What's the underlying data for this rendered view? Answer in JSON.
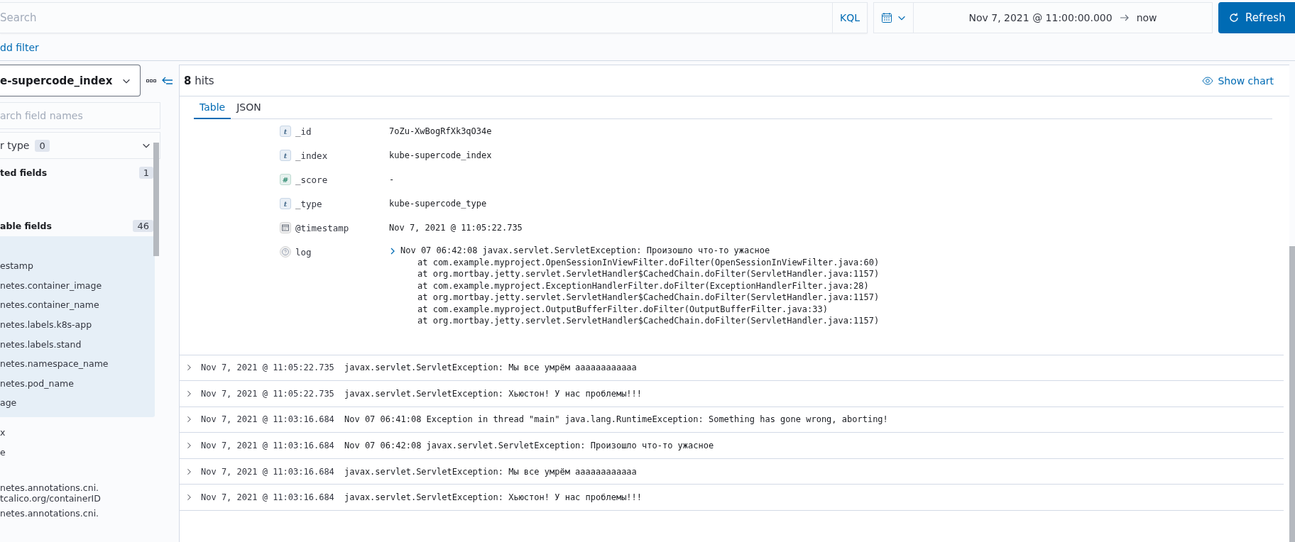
{
  "query_bar": {
    "placeholder": "Search",
    "language": "KQL"
  },
  "date_range": {
    "start": "Nov 7, 2021 @ 11:00:00.000",
    "end": "now"
  },
  "refresh_button": "Refresh",
  "add_filter": "dd filter",
  "sidebar": {
    "index_pattern": "e-supercode_index",
    "field_search": {
      "placeholder": "arch field names"
    },
    "type_filter": {
      "label": "r type",
      "count": "0"
    },
    "sections": [
      {
        "title": "ted fields",
        "count": "1"
      },
      {
        "title": "able fields",
        "count": "46",
        "fields": [
          "estamp",
          "netes.container_image",
          "netes.container_name",
          "netes.labels.k8s-app",
          "netes.labels.stand",
          "netes.namespace_name",
          "netes.pod_name",
          "age"
        ]
      }
    ],
    "other_fields": [
      [
        "x"
      ],
      [
        "e"
      ],
      [
        "netes.annotations.cni.",
        "tcalico.org/containerID"
      ],
      [
        "netes.annotations.cni."
      ]
    ]
  },
  "results": {
    "hits_count": "8",
    "hits_label": "hits",
    "show_chart": "Show chart",
    "tabs": [
      {
        "label": "Table",
        "selected": true
      },
      {
        "label": "JSON",
        "selected": false
      }
    ],
    "document": [
      {
        "kind": "string",
        "glyph": "t",
        "name": "_id",
        "value": "7oZu-XwBogRfXk3qO34e"
      },
      {
        "kind": "string",
        "glyph": "t",
        "name": "_index",
        "value": "kube-supercode_index"
      },
      {
        "kind": "number",
        "glyph": "#",
        "name": "_score",
        "value": "-"
      },
      {
        "kind": "string",
        "glyph": "t",
        "name": "_type",
        "value": "kube-supercode_type"
      },
      {
        "kind": "date",
        "name": "@timestamp",
        "value": "Nov 7, 2021 @ 11:05:22.735"
      },
      {
        "kind": "unknown",
        "name": "log",
        "lines": [
          "Nov 07 06:42:08 javax.servlet.ServletException: Произошло что-то ужасное",
          "at com.example.myproject.OpenSessionInViewFilter.doFilter(OpenSessionInViewFilter.java:60)",
          "at org.mortbay.jetty.servlet.ServletHandler$CachedChain.doFilter(ServletHandler.java:1157)",
          "at com.example.myproject.ExceptionHandlerFilter.doFilter(ExceptionHandlerFilter.java:28)",
          "at org.mortbay.jetty.servlet.ServletHandler$CachedChain.doFilter(ServletHandler.java:1157)",
          "at com.example.myproject.OutputBufferFilter.doFilter(OutputBufferFilter.java:33)",
          "at org.mortbay.jetty.servlet.ServletHandler$CachedChain.doFilter(ServletHandler.java:1157)"
        ]
      }
    ],
    "rows": [
      {
        "time": "Nov 7, 2021 @ 11:05:22.735",
        "message": "javax.servlet.ServletException: Мы все умрём аааааааааааа",
        "expanded": false
      },
      {
        "time": "Nov 7, 2021 @ 11:05:22.735",
        "message": "javax.servlet.ServletException: Хьюстон! У нас проблемы!!!",
        "expanded": false
      },
      {
        "time": "Nov 7, 2021 @ 11:03:16.684",
        "message": "Nov 07 06:41:08 Exception in thread \"main\" java.lang.RuntimeException: Something has gone wrong, aborting!",
        "expanded": false
      },
      {
        "time": "Nov 7, 2021 @ 11:03:16.684",
        "message": "Nov 07 06:42:08 javax.servlet.ServletException: Произошло что-то ужасное",
        "expanded": false
      },
      {
        "time": "Nov 7, 2021 @ 11:03:16.684",
        "message": "javax.servlet.ServletException: Мы все умрём аааааааааааа",
        "expanded": false
      },
      {
        "time": "Nov 7, 2021 @ 11:03:16.684",
        "message": "javax.servlet.ServletException: Хьюстон! У нас проблемы!!!",
        "expanded": false
      }
    ]
  }
}
